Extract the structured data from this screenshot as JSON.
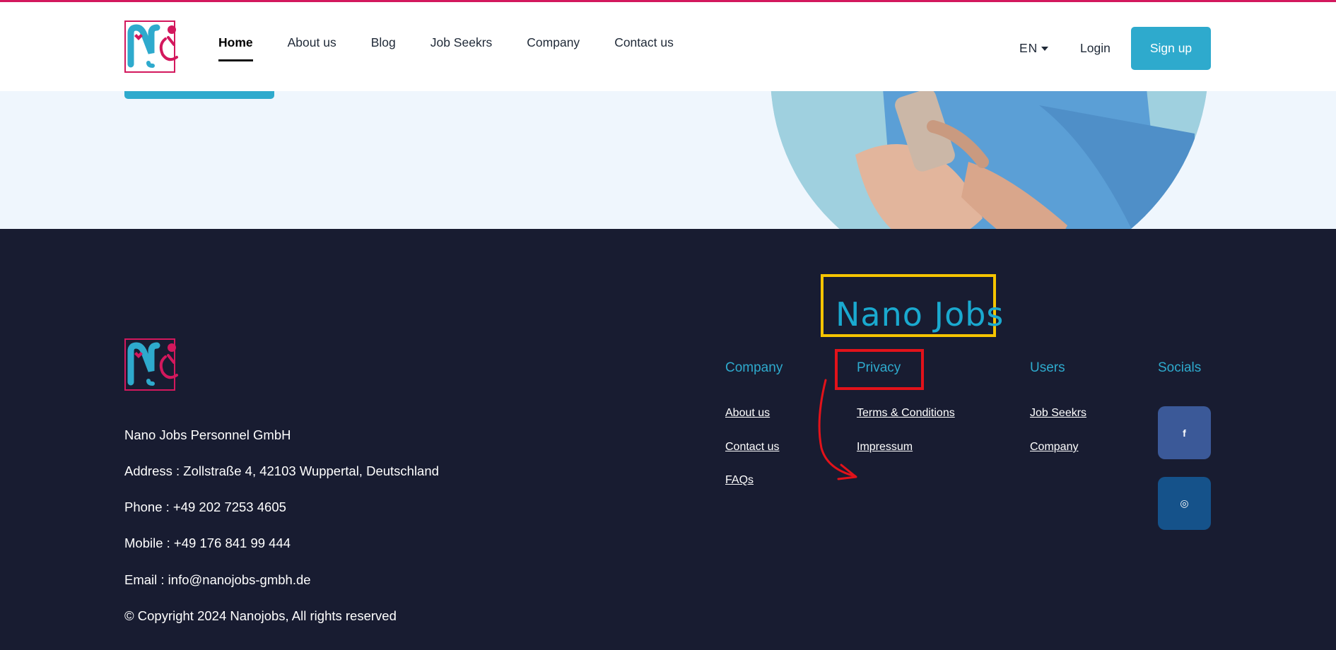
{
  "header": {
    "nav": [
      "Home",
      "About us",
      "Blog",
      "Job Seekrs",
      "Company",
      "Contact us"
    ],
    "active_nav": "Home",
    "language": "EN",
    "login": "Login",
    "signup": "Sign up"
  },
  "footer": {
    "company_name": "Nano Jobs Personnel GmbH",
    "address": "Address : Zollstraße 4, 42103 Wuppertal, Deutschland",
    "phone": "Phone : +49 202 7253 4605",
    "mobile": "Mobile : +49 176 841 99 444",
    "email": "Email : info@nanojobs-gmbh.de",
    "copyright": "© Copyright 2024 Nanojobs, All rights reserved",
    "columns": [
      {
        "heading": "Company",
        "links": [
          "About us",
          "Contact us",
          "FAQs"
        ]
      },
      {
        "heading": "Privacy",
        "links": [
          "Terms & Conditions",
          "Impressum"
        ]
      },
      {
        "heading": "Users",
        "links": [
          "Job Seekrs",
          "Company"
        ]
      },
      {
        "heading": "Socials",
        "links": []
      }
    ],
    "socials": [
      {
        "icon": "facebook-icon",
        "glyph": "f"
      },
      {
        "icon": "instagram-icon",
        "glyph": "◎"
      }
    ]
  },
  "annotations": {
    "handwritten_label": "Nano Jobs"
  },
  "colors": {
    "brand_blue": "#2eaacd",
    "brand_pink": "#d3185d",
    "footer_bg": "#181c31",
    "facebook": "#3b5998",
    "instagram": "#15528a",
    "annotation_yellow": "#f5c400",
    "annotation_red": "#e2121a"
  }
}
